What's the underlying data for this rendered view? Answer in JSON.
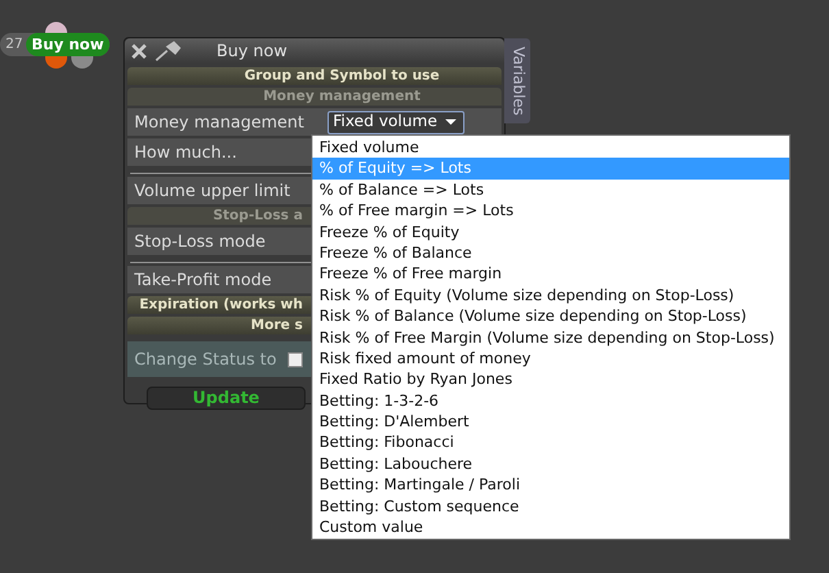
{
  "node": {
    "count": "27",
    "label": "Buy now"
  },
  "window": {
    "title": "Buy now",
    "side_tab": "Variables"
  },
  "sections": [
    {
      "kind": "header",
      "text": "Group and Symbol to use"
    },
    {
      "kind": "subheader",
      "text": "Money management"
    },
    {
      "kind": "select",
      "label": "Money management",
      "value": "Fixed volume"
    },
    {
      "kind": "row",
      "label": "How much..."
    },
    {
      "kind": "divider"
    },
    {
      "kind": "row",
      "label": "Volume upper limit"
    },
    {
      "kind": "subheader",
      "text": "Stop-Loss a"
    },
    {
      "kind": "row",
      "label": "Stop-Loss mode"
    },
    {
      "kind": "divider"
    },
    {
      "kind": "row",
      "label": "Take-Profit mode"
    },
    {
      "kind": "header",
      "text": "Expiration (works wh"
    },
    {
      "kind": "header",
      "text": "More s"
    },
    {
      "kind": "checkbox",
      "label": "Change Status to",
      "checked": false
    }
  ],
  "update_button": "Update",
  "dropdown": [
    {
      "label": "Fixed volume",
      "selected": false
    },
    {
      "label": "% of Equity => Lots",
      "selected": true
    },
    {
      "label": "% of Balance => Lots",
      "selected": false
    },
    {
      "label": "% of Free margin => Lots",
      "selected": false
    },
    {
      "label": "Freeze % of Equity",
      "selected": false
    },
    {
      "label": "Freeze % of Balance",
      "selected": false
    },
    {
      "label": "Freeze % of Free margin",
      "selected": false
    },
    {
      "label": "Risk % of Equity (Volume size depending on Stop-Loss)",
      "selected": false
    },
    {
      "label": "Risk % of Balance (Volume size depending on Stop-Loss)",
      "selected": false
    },
    {
      "label": "Risk % of Free Margin (Volume size depending on Stop-Loss)",
      "selected": false
    },
    {
      "label": "Risk fixed amount of money",
      "selected": false
    },
    {
      "label": "Fixed Ratio by Ryan Jones",
      "selected": false
    },
    {
      "label": "Betting: 1-3-2-6",
      "selected": false
    },
    {
      "label": "Betting: D'Alembert",
      "selected": false
    },
    {
      "label": "Betting: Fibonacci",
      "selected": false
    },
    {
      "label": "Betting: Labouchere",
      "selected": false
    },
    {
      "label": "Betting: Martingale / Paroli",
      "selected": false
    },
    {
      "label": "Betting: Custom sequence",
      "selected": false
    },
    {
      "label": "Custom value",
      "selected": false
    }
  ]
}
